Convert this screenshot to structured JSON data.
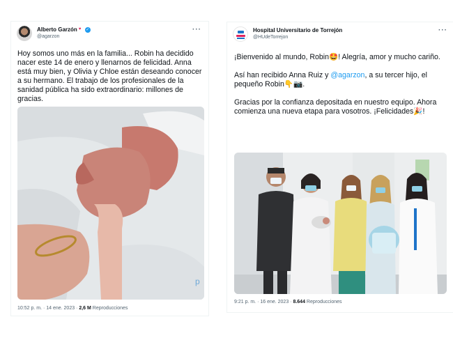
{
  "left_tweet": {
    "author_name": "Alberto Garzón",
    "handle": "@agarzon",
    "text": "Hoy somos uno más en la familia... Robin ha decidido nacer este 14 de enero y llenarnos de felicidad. Anna está muy bien, y Olivia y Chloe están deseando conocer a su hermano. El trabajo de los profesionales de la sanidad pública ha sido extraordinario: millones de gracias.",
    "time": "10:52 p. m. · 14 ene. 2023 · ",
    "views_count": "2,6 M",
    "views_label": " Reproducciones"
  },
  "right_tweet": {
    "author_name": "Hospital Universitario de Torrejón",
    "handle": "@HUdeTorrejon",
    "text_line1": "¡Bienvenido al mundo, Robin🤩! Alegría, amor y mucho cariño.",
    "text_line2_pre": "Así han recibido Anna Ruiz y ",
    "mention": "@agarzon",
    "text_line2_post": ", a su tercer hijo, el pequeño Robin👇📷.",
    "text_line3": "Gracias por la confianza depositada en nuestro equipo. Ahora comienza una nueva etapa para vosotros. ¡Felicidades🎉!",
    "time": "9:21 p. m. · 16 ene. 2023 · ",
    "views_count": "8.644",
    "views_label": " Reproducciones"
  },
  "icons": {
    "more": "···",
    "heart": "♥",
    "verified": "✓"
  }
}
